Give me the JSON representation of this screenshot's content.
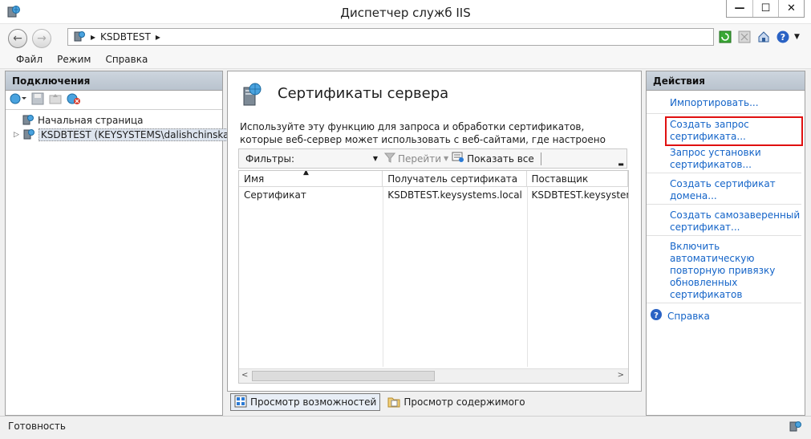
{
  "window": {
    "title": "Диспетчер служб IIS",
    "controls": {
      "minimize": "—",
      "maximize": "☐",
      "close": "✕"
    }
  },
  "address": {
    "segments": [
      "KSDBTEST"
    ]
  },
  "menu": {
    "file": "Файл",
    "view": "Режим",
    "help": "Справка"
  },
  "connections": {
    "header": "Подключения",
    "tree": [
      {
        "label": "Начальная страница"
      },
      {
        "label": "KSDBTEST (KEYSYSTEMS\\dalishchinskaya)"
      }
    ]
  },
  "feature": {
    "title": "Сертификаты сервера",
    "description": "Используйте эту функцию для запроса и обработки сертификатов, которые веб-сервер может использовать с веб-сайтами, где настроено использование SSL.",
    "filter_label": "Фильтры:",
    "go_label": "Перейти",
    "show_all_label": "Показать все",
    "columns": [
      "Имя",
      "Получатель сертификата",
      "Поставщик"
    ],
    "rows": [
      [
        "Сертификат",
        "KSDBTEST.keysystems.local",
        "KSDBTEST.keysystems."
      ]
    ]
  },
  "viewtabs": {
    "features": "Просмотр возможностей",
    "content": "Просмотр содержимого"
  },
  "actions": {
    "header": "Действия",
    "items": [
      "Импортировать...",
      "Создать запрос сертификата...",
      "Запрос установки сертификатов...",
      "Создать сертификат домена...",
      "Создать самозаверенный сертификат...",
      "Включить автоматическую повторную привязку обновленных сертификатов",
      "Справка"
    ]
  },
  "status": {
    "text": "Готовность"
  },
  "colors": {
    "link": "#1464c8",
    "highlight": "#e01010",
    "pane_header": "#c3ccd6"
  }
}
